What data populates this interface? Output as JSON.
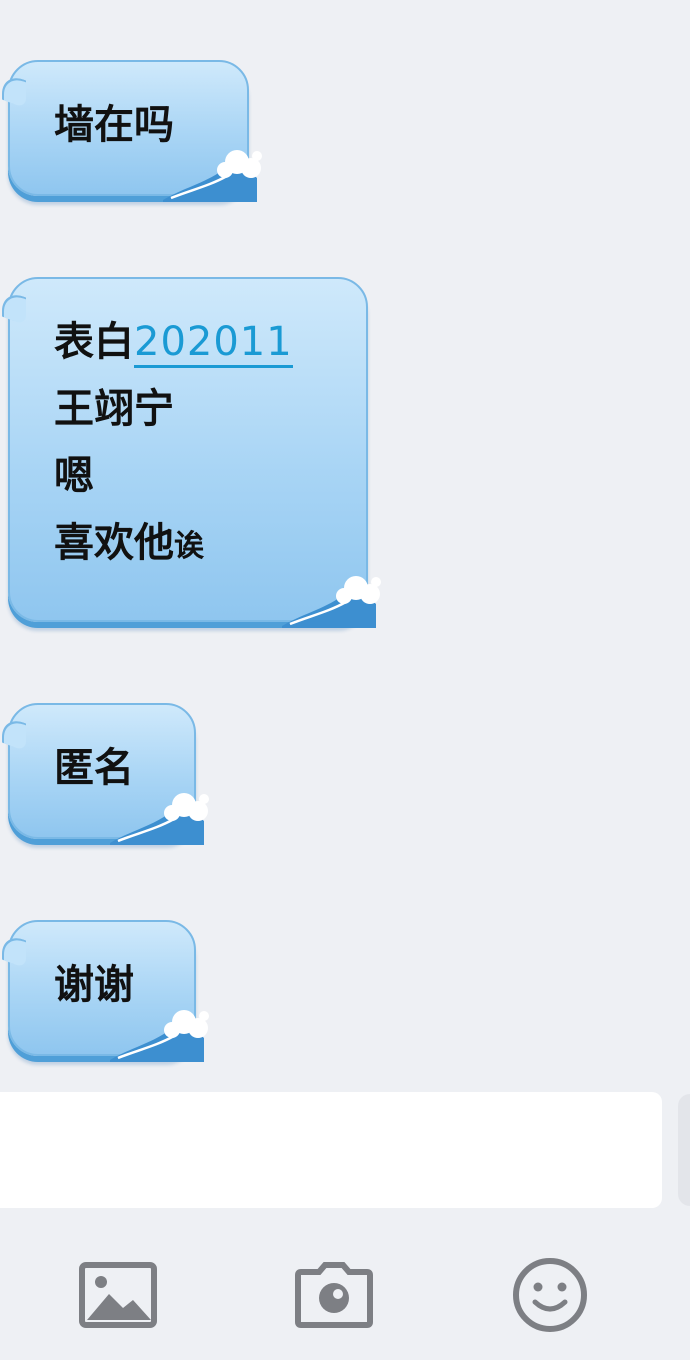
{
  "messages": [
    {
      "lines": [
        "墙在吗"
      ]
    },
    {
      "lines": [
        [
          "表白",
          "202011"
        ],
        "王翊宁",
        "嗯",
        [
          "喜欢他",
          "诶"
        ]
      ]
    },
    {
      "lines": [
        "匿名"
      ]
    },
    {
      "lines": [
        "谢谢"
      ]
    }
  ],
  "composer": {
    "input_value": "",
    "tools": [
      "image-icon",
      "camera-icon",
      "emoji-icon"
    ]
  },
  "colors": {
    "background": "#eef0f4",
    "bubble": "#a9d5f5",
    "link": "#1a9ad4",
    "icon": "#7d7f84"
  }
}
